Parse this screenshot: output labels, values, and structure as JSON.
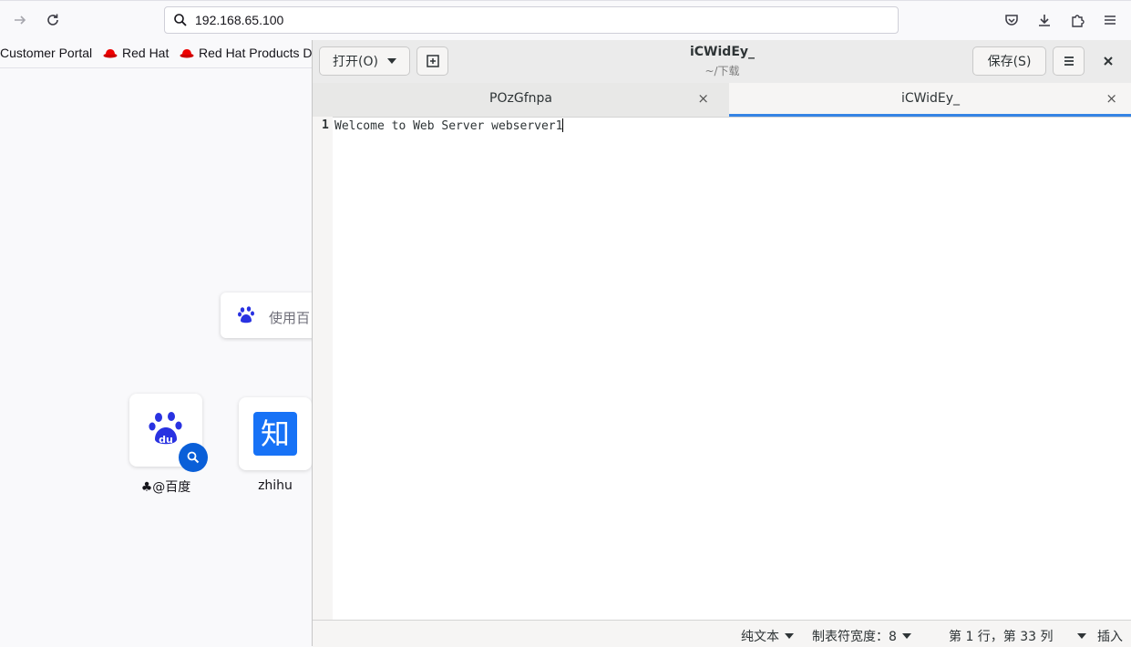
{
  "browser": {
    "url": "192.168.65.100",
    "bookmarks": [
      {
        "label": "Customer Portal"
      },
      {
        "label": "Red Hat"
      },
      {
        "label": "Red Hat Products D"
      }
    ],
    "newtab": {
      "search_placeholder": "使用百",
      "tiles": [
        {
          "label": "♣@百度",
          "icon": "baidu-icon"
        },
        {
          "label": "zhihu",
          "icon": "zhihu-icon",
          "glyph": "知"
        }
      ]
    }
  },
  "editor": {
    "open_label": "打开(O)",
    "title": "iCWidEy_",
    "subtitle": "~/下载",
    "save_label": "保存(S)",
    "tabs": [
      {
        "label": "POzGfnpa",
        "active": false
      },
      {
        "label": "iCWidEy_",
        "active": true
      }
    ],
    "lines": [
      {
        "number": "1",
        "text": "Welcome to Web Server webserver1"
      }
    ],
    "status": {
      "syntax": "纯文本",
      "tab_width": "制表符宽度：8",
      "position": "第 1 行，第 33 列",
      "mode": "插入"
    },
    "accent_color": "#3584e4"
  }
}
